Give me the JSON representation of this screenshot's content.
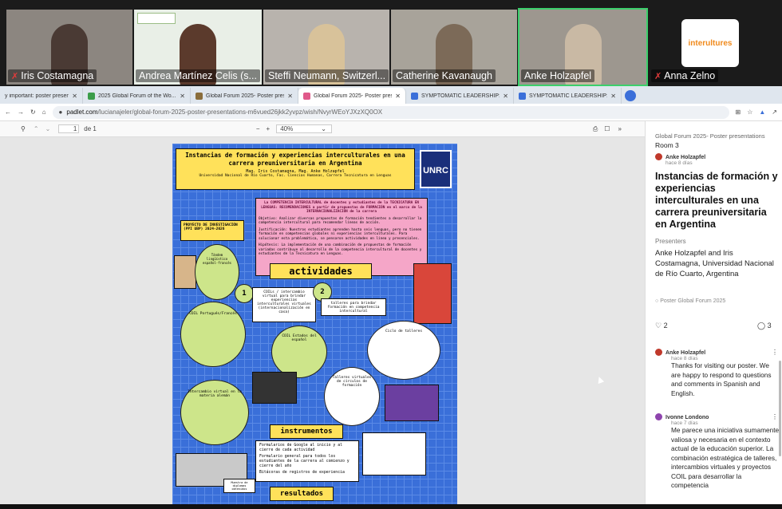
{
  "participants": [
    {
      "name": "Iris Costamagna",
      "muted": true
    },
    {
      "name": "Andrea Martínez Celis (s...",
      "muted": false
    },
    {
      "name": "Steffi Neumann, Switzerl...",
      "muted": false
    },
    {
      "name": "Catherine Kavanaugh",
      "muted": false
    },
    {
      "name": "Anke Holzapfel",
      "muted": false
    },
    {
      "name": "Anna Zelno",
      "muted": true
    }
  ],
  "logo_text": "interultures",
  "tabs": [
    {
      "label": "y important: poster presenta"
    },
    {
      "label": "2025 Global Forum of the Wo..."
    },
    {
      "label": "Global Forum 2025- Poster pres"
    },
    {
      "label": "Global Forum 2025- Poster pres"
    },
    {
      "label": "SYMPTOMATIC LEADERSHIP: TH"
    },
    {
      "label": "SYMPTOMATIC LEADERSHIP: TH"
    }
  ],
  "url": {
    "domain": "padlet.com",
    "path": "/lucianajeler/global-forum-2025-poster-presentations-m6vued26jkk2yvpz/wish/NvyrWEoYJXzXQ0OX"
  },
  "pdf": {
    "page": "1",
    "page_total": "de 1",
    "zoom": "40%"
  },
  "poster": {
    "title": "Instancias de formación y experiencias interculturales en una carrera preuniversitaria en Argentina",
    "authors": "Mag. Iris Costamagna, Mag. Anke Holzapfel",
    "affiliation": "Universidad Nacional de Río Cuarto, Fac. Ciencias Humanas, Carrera Tecnicatura en Lenguas",
    "logo": "UNRC",
    "project": "PROYECTO DE INVESTIGACIÓN (PPI UBP) 2024-2026",
    "competence": "La COMPETENCIA INTERCULTURAL de docentes y estudiantes de la TECNICATURA EN LENGUAS: RECOMENDACIONES a partir de propuestas de FORMACIÓN en el marco de la INTERNACIONALIZACIÓN de la carrera",
    "objective": "Objetivo: Analizar diversas propuestas de formación tendientes a desarrollar la competencia intercultural para recomendar líneas de acción.",
    "justification": "Justificación: Nuestros estudiantes aprenden hasta seis lenguas, pero no tienen formación en competencias globales ni experiencias interculturales. Para solucionar esta problemática, se pensaron actividades en línea y presenciales.",
    "hypothesis": "Hipótesis: La implementación de una combinación de propuestas de formación variadas contribuye al desarrollo de la competencia intercultural de docentes y estudiantes de la Tecnicatura en Lenguas.",
    "activities": "actividades",
    "act1_num": "1",
    "act1": "COILs / intercambio virtual para brindar experiencias interculturales virtuales (internacionalización en casa)",
    "act2_num": "2",
    "act2": "talleres para brindar formación en competencia intercultural",
    "tandem": "Tándem lingüístico español-francés",
    "coil_pt": "COIL Portugués/Francés",
    "coil_es": "COIL Estados del español",
    "ciclo": "Ciclo de talleres",
    "talleres_virt": "Talleres virtuales de círculos de formación",
    "inter_virt": "Intercambio virtual en la materia alemán",
    "instrumentos": "instrumentos",
    "instr_items": [
      "Formularios de Google al inicio y al cierre de cada actividad",
      "Formulario general para todos los estudiantes de la carrera al comienzo y cierre del año",
      "Bitácoras de registros de experiencia"
    ],
    "resultados": "resultados",
    "certificados": "Muestra de diplomas obtenidos"
  },
  "sidebar": {
    "board": "Global Forum 2025- Poster presentations",
    "room": "Room 3",
    "author": "Anke Holzapfel",
    "author_time": "hace 8 días",
    "title": "Instancias de formación y experiencias interculturales en una carrera preuniversitaria en Argentina",
    "presenters_label": "Presenters",
    "presenters": "Anke Holzapfel and Iris Costamagna, Universidad Nacional de Río Cuarto, Argentina",
    "section": "Poster Global Forum 2025",
    "likes": "2",
    "comments_count": "3",
    "comments": [
      {
        "author": "Anke Holzapfel",
        "time": "hace 8 días",
        "text": "Thanks for visiting our poster. We are happy to respond to questions and comments in Spanish and English."
      },
      {
        "author": "Ivonne Londono",
        "time": "hace 7 días",
        "text": "Me parece una iniciativa sumamente valiosa y necesaria en el contexto actual de la educación superior. La combinación estratégica de talleres, intercambios virtuales y proyectos COIL para desarrollar la competencia"
      }
    ]
  },
  "colors": {
    "active_speaker": "#3ccf6c",
    "poster_bg": "#3a6fd9",
    "poster_yellow": "#ffe15a",
    "poster_pink": "#f5a6c8",
    "poster_green": "#cde58a"
  }
}
